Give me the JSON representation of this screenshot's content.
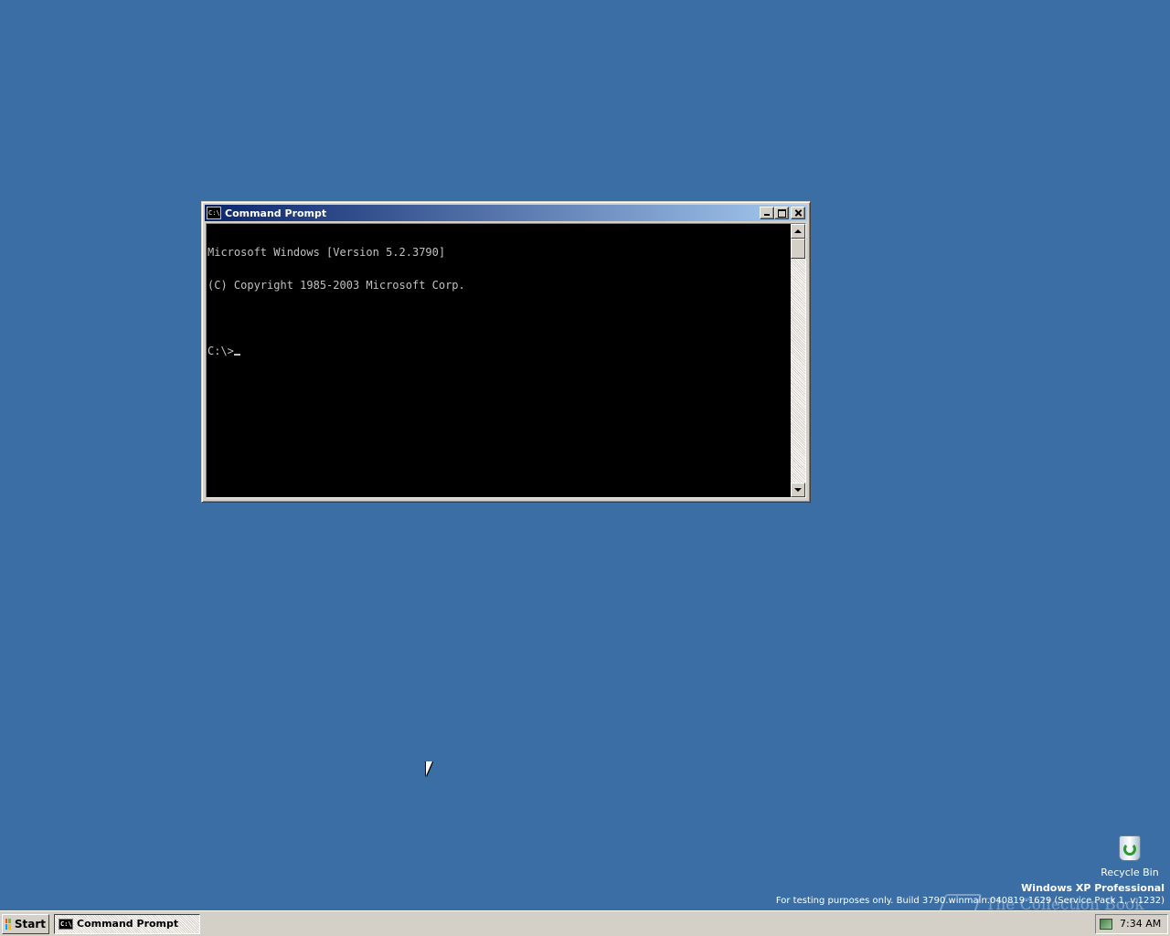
{
  "window": {
    "title": "Command Prompt",
    "icon_text": "C:\\",
    "console_lines": [
      "Microsoft Windows [Version 5.2.3790]",
      "(C) Copyright 1985-2003 Microsoft Corp.",
      "",
      "C:\\>"
    ]
  },
  "desktop": {
    "recycle_bin_label": "Recycle Bin",
    "edition": "Windows XP Professional",
    "build_info": "For testing purposes only. Build 3790.winmain.040819-1629 (Service Pack 1, v.1232)",
    "watermark": "The Collection Book"
  },
  "taskbar": {
    "start_label": "Start",
    "task_label": "Command Prompt",
    "task_icon_text": "C:\\",
    "clock": "7:34 AM"
  },
  "colors": {
    "desktop": "#3a6ea5",
    "titlebar_start": "#0a246a",
    "titlebar_end": "#a6caf0",
    "console_bg": "#000000",
    "console_fg": "#c0c0c0"
  },
  "icons": {
    "window": "console-icon",
    "recycle": "recycle-bin-icon",
    "start": "windows-logo-icon",
    "tray": "network-tray-icon"
  }
}
